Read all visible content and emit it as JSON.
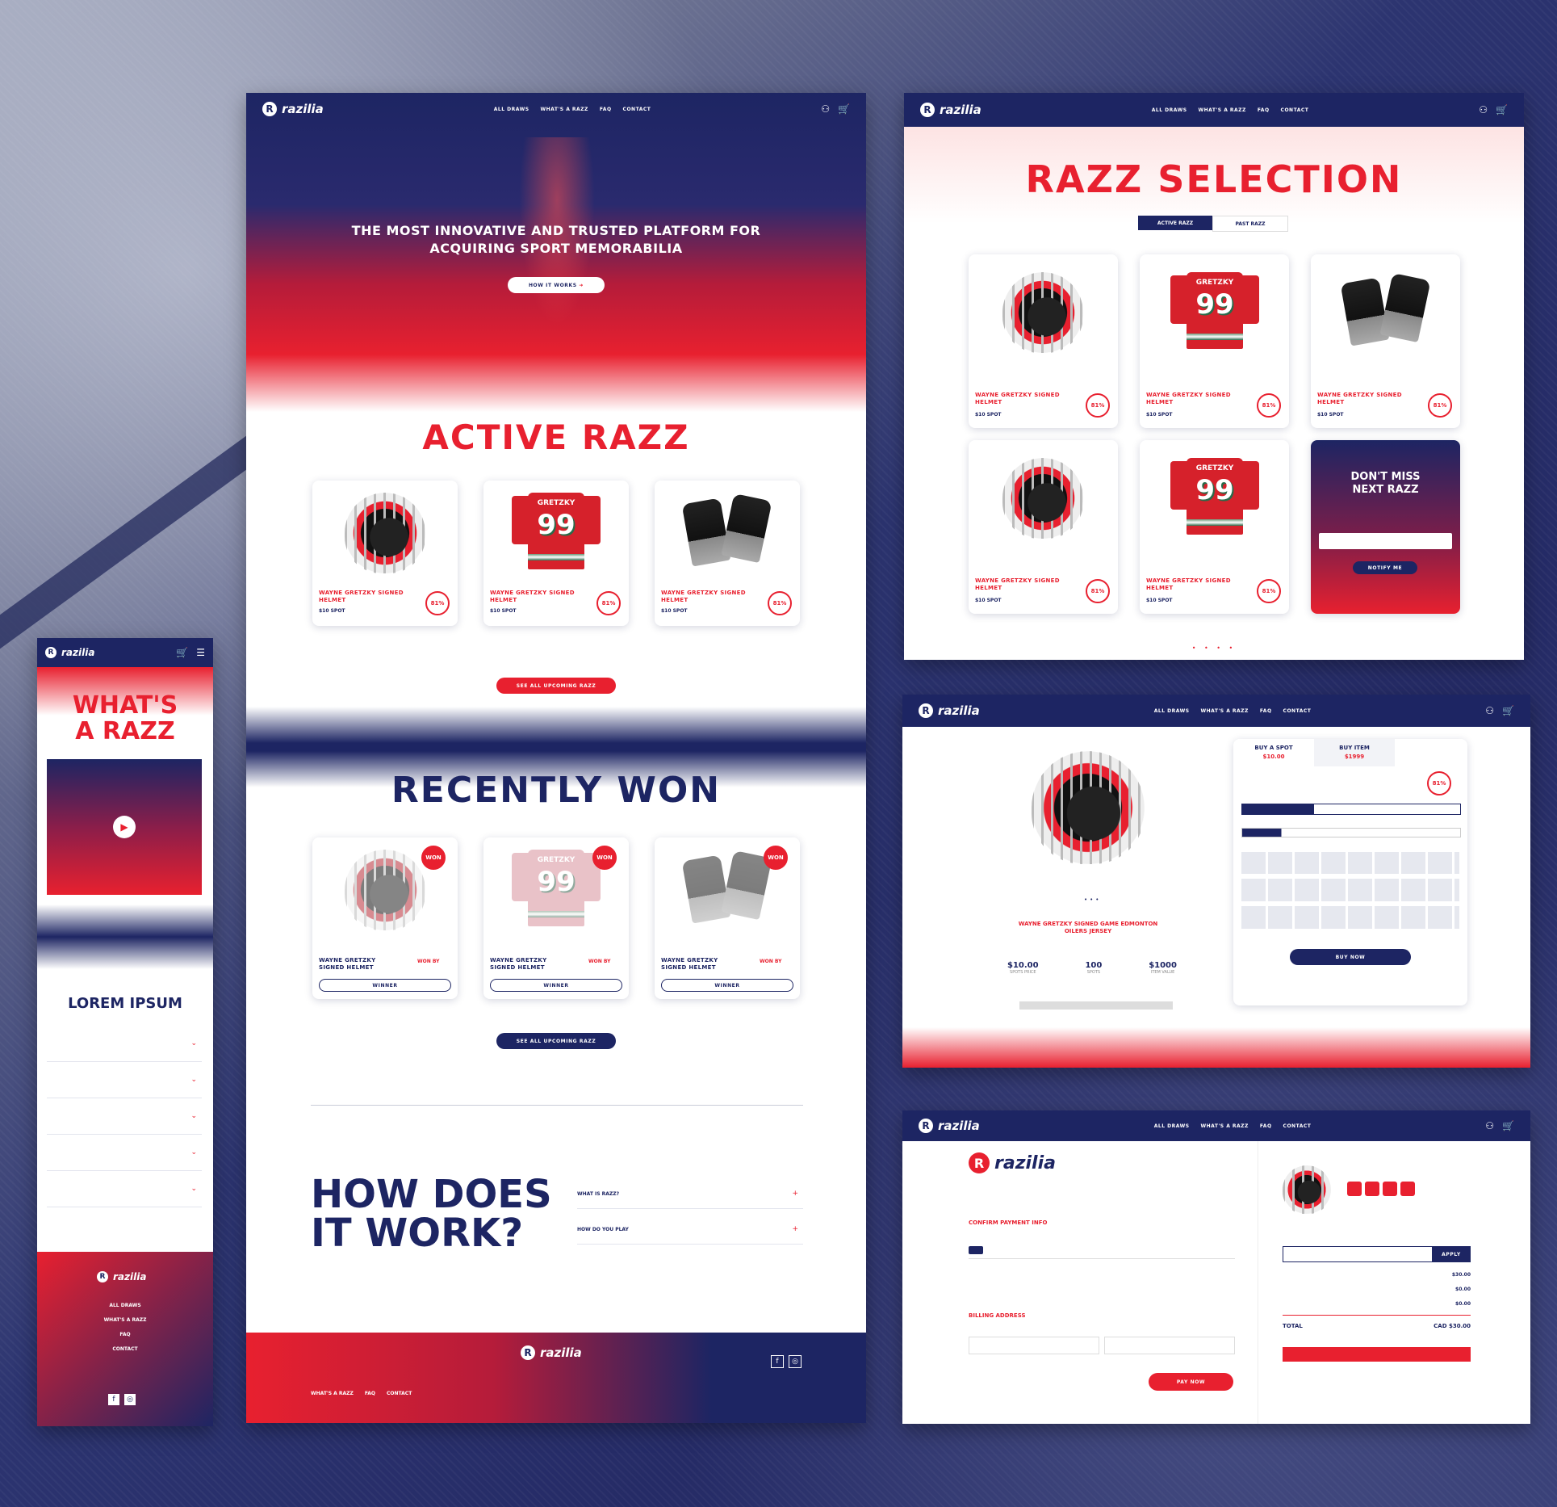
{
  "brand": {
    "name": "razilia",
    "mark": "R",
    "navy": "#1d2563",
    "red": "#e8202f"
  },
  "nav": {
    "links": [
      "ALL DRAWS",
      "WHAT'S A RAZZ",
      "FAQ",
      "CONTACT"
    ],
    "user_icon": "user-icon",
    "cart_icon": "cart-icon"
  },
  "home": {
    "hero_title": "THE MOST INNOVATIVE AND TRUSTED PLATFORM FOR ACQUIRING SPORT MEMORABILIA",
    "hero_cta": "HOW IT WORKS",
    "active_title": "ACTIVE RAZZ",
    "active_items": [
      {
        "title": "WAYNE GRETZKY SIGNED HELMET",
        "sub": "$10 SPOT",
        "badge": "81%"
      },
      {
        "title": "WAYNE GRETZKY SIGNED HELMET",
        "sub": "$10 SPOT",
        "badge": "81%"
      },
      {
        "title": "WAYNE GRETZKY SIGNED HELMET",
        "sub": "$10 SPOT",
        "badge": "81%"
      }
    ],
    "active_cta": "SEE ALL UPCOMING RAZZ",
    "recent_title": "RECENTLY WON",
    "recent_items": [
      {
        "title": "WAYNE GRETZKY SIGNED HELMET",
        "winner": "WON BY",
        "button": "WINNER",
        "tag": "WON"
      },
      {
        "title": "WAYNE GRETZKY SIGNED HELMET",
        "winner": "WON BY",
        "button": "WINNER",
        "tag": "WON"
      },
      {
        "title": "WAYNE GRETZKY SIGNED HELMET",
        "winner": "WON BY",
        "button": "WINNER",
        "tag": "WON"
      }
    ],
    "recent_cta": "SEE ALL UPCOMING RAZZ",
    "how_title_1": "HOW DOES",
    "how_title_2": "IT WORK?",
    "faq": [
      "WHAT IS RAZZ?",
      "HOW DO YOU PLAY"
    ],
    "footer_logo": "razilia",
    "footer_links": [
      "WHAT'S A RAZZ",
      "FAQ",
      "CONTACT"
    ]
  },
  "mobile": {
    "title_1": "WHAT'S",
    "title_2": "A RAZZ",
    "lorem_title": "LOREM IPSUM",
    "footer_links": [
      "ALL DRAWS",
      "WHAT'S A RAZZ",
      "FAQ",
      "CONTACT"
    ]
  },
  "selection": {
    "title": "RAZZ SELECTION",
    "tabs": [
      "ACTIVE RAZZ",
      "PAST RAZZ"
    ],
    "items": [
      {
        "title": "WAYNE GRETZKY SIGNED HELMET",
        "sub": "$10 SPOT",
        "badge": "81%"
      },
      {
        "title": "WAYNE GRETZKY SIGNED HELMET",
        "sub": "$10 SPOT",
        "badge": "81%"
      },
      {
        "title": "WAYNE GRETZKY SIGNED HELMET",
        "sub": "$10 SPOT",
        "badge": "81%"
      },
      {
        "title": "WAYNE GRETZKY SIGNED HELMET",
        "sub": "$10 SPOT",
        "badge": "81%"
      },
      {
        "title": "WAYNE GRETZKY SIGNED HELMET",
        "sub": "$10 SPOT",
        "badge": "81%"
      }
    ],
    "promo_title_1": "DON'T MISS",
    "promo_title_2": "NEXT RAZZ",
    "promo_button": "NOTIFY ME"
  },
  "detail": {
    "buy_spot": "BUY A SPOT",
    "buy_spot_price": "$10.00",
    "buy_item": "BUY ITEM",
    "buy_item_price": "$1999",
    "badge": "81%",
    "product_title": "WAYNE GRETZKY SIGNED GAME EDMONTON OILERS JERSEY",
    "stats": [
      {
        "value": "$10.00",
        "label": "SPOTS PRICE"
      },
      {
        "value": "100",
        "label": "SPOTS"
      },
      {
        "value": "$1000",
        "label": "ITEM VALUE"
      }
    ],
    "buy_now": "BUY NOW"
  },
  "checkout": {
    "logo": "razilia",
    "section_payment": "CONFIRM PAYMENT INFO",
    "section_billing": "BILLING ADDRESS",
    "pay_button": "PAY NOW",
    "promo_button": "APPLY",
    "total_label": "TOTAL",
    "total_value": "CAD $30.00",
    "summary_values": [
      "$30.00",
      "$0.00",
      "$0.00"
    ]
  }
}
